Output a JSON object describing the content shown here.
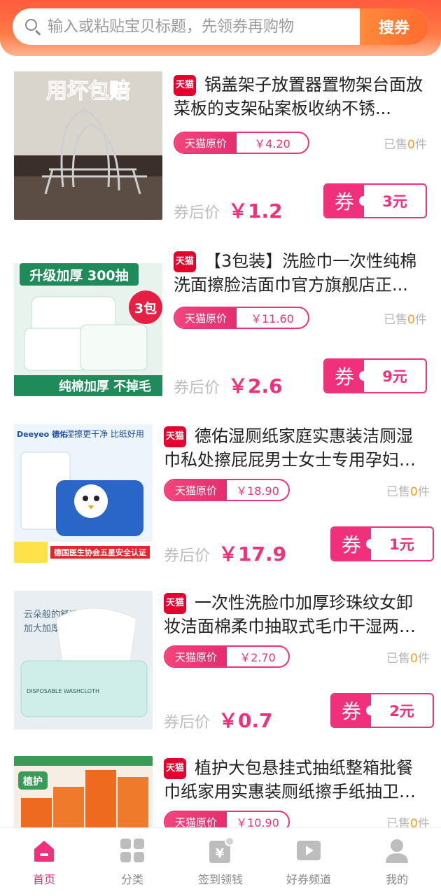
{
  "search": {
    "placeholder": "输入或粘贴宝贝标题，先领券再购物",
    "button_label": "搜券"
  },
  "labels": {
    "tmall_badge": "天猫",
    "orig_price_label": "天猫原价",
    "sold_prefix": "已售",
    "sold_suffix": "件",
    "after_label": "券后价",
    "coupon_label": "券"
  },
  "products": [
    {
      "title": "锅盖架子放置器置物架台面放菜板的支架砧案板收纳不锈...",
      "orig_price": "￥4.20",
      "sold": "0",
      "after_price": "￥1.2",
      "coupon": "3元",
      "image_text": "用坏包赔"
    },
    {
      "title": "【3包装】洗脸巾一次性纯棉洗面擦脸洁面巾官方旗舰店正...",
      "orig_price": "￥11.60",
      "sold": "0",
      "after_price": "￥2.6",
      "coupon": "9元",
      "image_text": "升级加厚 300抽",
      "image_badge": "3包",
      "image_footer": "纯棉加厚 不掉毛"
    },
    {
      "title": "德佑湿厕纸家庭实惠装洁厕湿巾私处擦屁屁男士女士专用孕妇湿厕巾",
      "orig_price": "￥18.90",
      "sold": "0",
      "after_price": "￥17.9",
      "coupon": "1元",
      "image_text": "湿擦更干净 比纸好用",
      "image_brand": "Deeyeo 德佑",
      "image_footer": "德国医生协会五星安全认证"
    },
    {
      "title": "一次性洗脸巾加厚珍珠纹女卸妆洁面棉柔巾抽取式毛巾干湿两用化妆",
      "orig_price": "￥2.70",
      "sold": "0",
      "after_price": "￥0.7",
      "coupon": "2元",
      "image_text": "云朵般的舒适",
      "image_text2": "加大加厚",
      "image_pkg": "DISPOSABLE WASHCLOTH"
    },
    {
      "title": "植护大包悬挂式抽纸整箱批餐巾纸家用实惠装厕纸擦手纸抽卫生纸巾",
      "orig_price": "￥10.90",
      "sold": "0",
      "image_text": "植护"
    }
  ],
  "tabs": [
    {
      "label": "首页",
      "icon": "home-icon",
      "active": true
    },
    {
      "label": "分类",
      "icon": "category-icon",
      "active": false
    },
    {
      "label": "签到领钱",
      "icon": "checkin-icon",
      "active": false
    },
    {
      "label": "好券频道",
      "icon": "coupon-channel-icon",
      "active": false
    },
    {
      "label": "我的",
      "icon": "user-icon",
      "active": false
    }
  ],
  "colors": {
    "accent": "#f0307a",
    "header": "#ff6b3d",
    "tmall_red": "#e5002d",
    "sold_num": "#ff9a1f"
  }
}
